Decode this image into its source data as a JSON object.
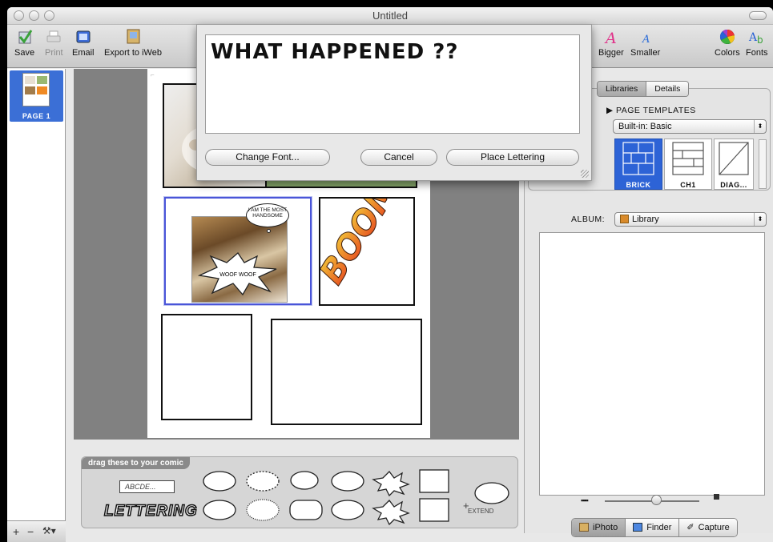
{
  "window": {
    "title": "Untitled"
  },
  "toolbar": {
    "save": "Save",
    "print": "Print",
    "email": "Email",
    "export": "Export to iWeb",
    "bigger": "Bigger",
    "smaller": "Smaller",
    "colors": "Colors",
    "fonts": "Fonts"
  },
  "pages": [
    {
      "label": "PAGE 1"
    }
  ],
  "comic": {
    "thought_text": "I AM THE MOST HANDSOME",
    "shout_text": "WOOF WOOF",
    "boom_text": "BOOM !!!!"
  },
  "dialog": {
    "text": "WHAT HAPPENED ??",
    "change_font": "Change Font...",
    "cancel": "Cancel",
    "place": "Place Lettering"
  },
  "tray": {
    "title": "drag these to your comic",
    "field_sample": "ABCDE...",
    "lettering": "LETTERING",
    "extend": "EXTEND"
  },
  "sidebar": {
    "tabs": [
      "Libraries",
      "Details"
    ],
    "section": "PAGE TEMPLATES",
    "template_popup": "Built-in: Basic",
    "templates": [
      "BRICK",
      "CH1",
      "DIAG..."
    ],
    "album_label": "ALBUM:",
    "album_popup": "Library",
    "sources": [
      "iPhoto",
      "Finder",
      "Capture"
    ]
  },
  "colors": {
    "selection": "#2d63d6",
    "canvas": "#818181",
    "boom_start": "#f4d23a",
    "boom_end": "#e53c1d"
  }
}
